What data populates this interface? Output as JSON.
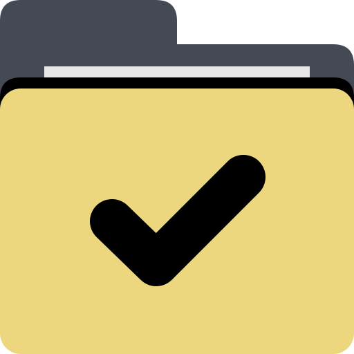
{
  "icon": {
    "name": "folder-check-icon",
    "colors": {
      "folder_back": "#444955",
      "folder_front": "#ecd67e",
      "paper": "#e6e6e6",
      "shadow": "#000000",
      "checkmark": "#000000"
    }
  }
}
